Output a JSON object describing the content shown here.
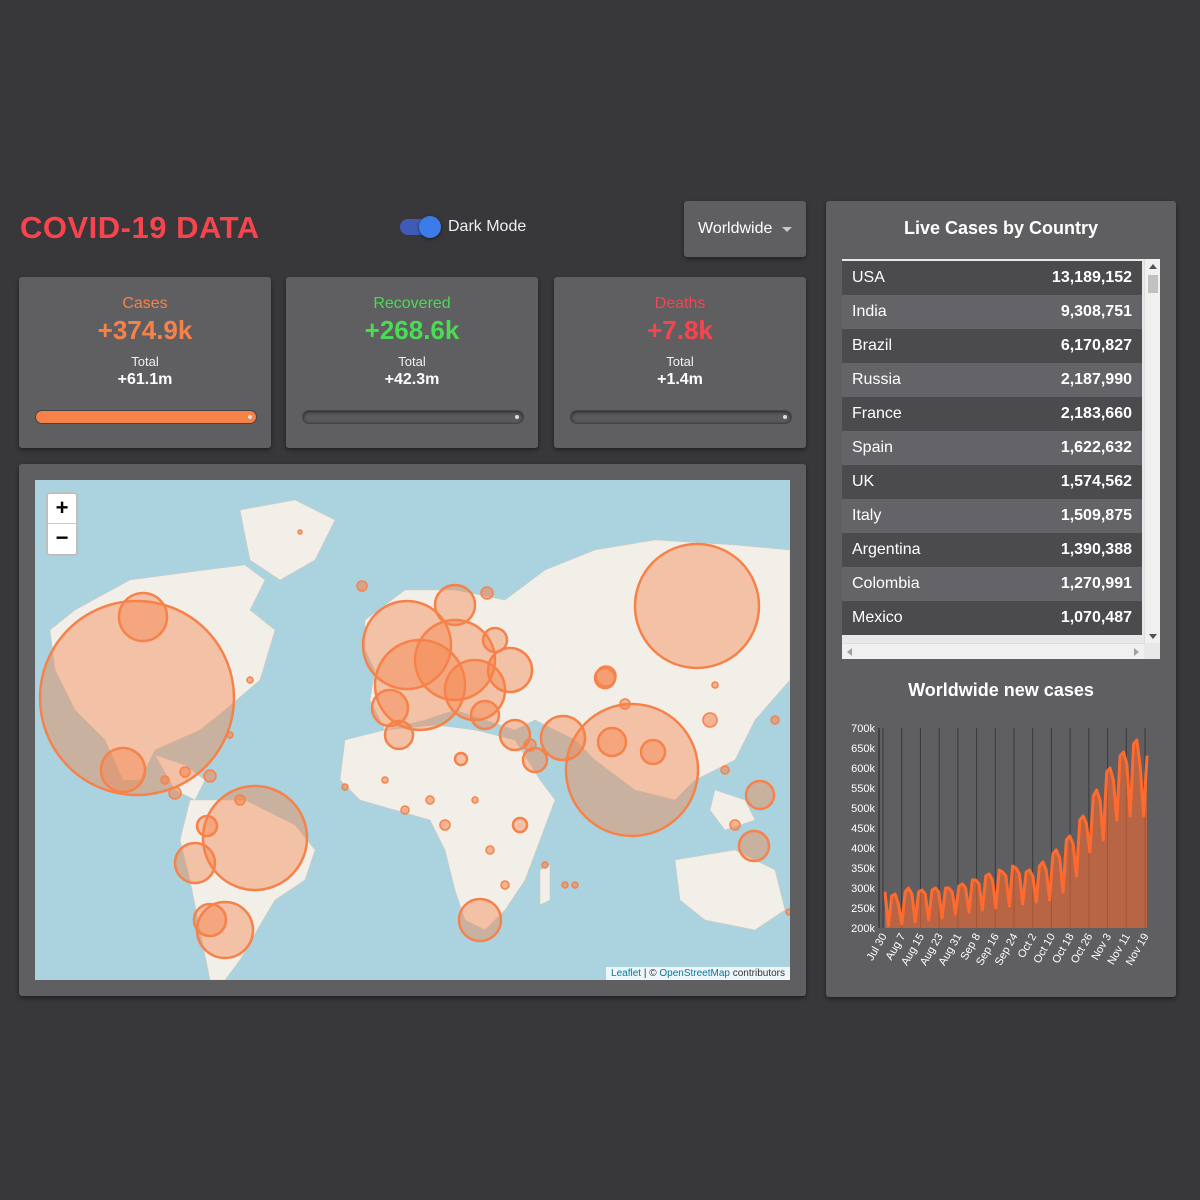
{
  "header": {
    "title": "COVID-19 DATA",
    "dark_mode_label": "Dark Mode",
    "dark_mode_on": true,
    "country_select": "Worldwide"
  },
  "cards": [
    {
      "title": "Cases",
      "today": "+374.9k",
      "total_label": "Total",
      "total": "+61.1m",
      "color": "#f6824a",
      "active": true
    },
    {
      "title": "Recovered",
      "today": "+268.6k",
      "total_label": "Total",
      "total": "+42.3m",
      "color": "#4bdb55",
      "active": false
    },
    {
      "title": "Deaths",
      "today": "+7.8k",
      "total_label": "Total",
      "total": "+1.4m",
      "color": "#f9444e",
      "active": false
    }
  ],
  "map": {
    "zoom_in": "+",
    "zoom_out": "−",
    "attribution_leaflet": "Leaflet",
    "attribution_sep": " | © ",
    "attribution_osm": "OpenStreetMap",
    "attribution_tail": " contributors",
    "circle_color": "#f6824a"
  },
  "table": {
    "title": "Live Cases by Country",
    "rows": [
      {
        "country": "USA",
        "cases": "13,189,152"
      },
      {
        "country": "India",
        "cases": "9,308,751"
      },
      {
        "country": "Brazil",
        "cases": "6,170,827"
      },
      {
        "country": "Russia",
        "cases": "2,187,990"
      },
      {
        "country": "France",
        "cases": "2,183,660"
      },
      {
        "country": "Spain",
        "cases": "1,622,632"
      },
      {
        "country": "UK",
        "cases": "1,574,562"
      },
      {
        "country": "Italy",
        "cases": "1,509,875"
      },
      {
        "country": "Argentina",
        "cases": "1,390,388"
      },
      {
        "country": "Colombia",
        "cases": "1,270,991"
      },
      {
        "country": "Mexico",
        "cases": "1,070,487"
      }
    ]
  },
  "chart_data": {
    "type": "area",
    "title": "Worldwide new cases",
    "y_ticks": [
      "200k",
      "250k",
      "300k",
      "350k",
      "400k",
      "450k",
      "500k",
      "550k",
      "600k",
      "650k",
      "700k"
    ],
    "ylim": [
      200000,
      700000
    ],
    "x_ticks": [
      "Jul 30",
      "Aug 7",
      "Aug 15",
      "Aug 23",
      "Aug 31",
      "Sep 8",
      "Sep 16",
      "Sep 24",
      "Oct 2",
      "Oct 10",
      "Oct 18",
      "Oct 26",
      "Nov 3",
      "Nov 11",
      "Nov 19"
    ],
    "grid": true,
    "line_color": "#ff6b2e",
    "values": [
      290000,
      205000,
      280000,
      285000,
      260000,
      210000,
      290000,
      300000,
      285000,
      215000,
      290000,
      295000,
      285000,
      220000,
      295000,
      300000,
      290000,
      225000,
      300000,
      300000,
      290000,
      235000,
      305000,
      310000,
      300000,
      240000,
      320000,
      320000,
      310000,
      245000,
      330000,
      335000,
      320000,
      250000,
      345000,
      340000,
      330000,
      255000,
      355000,
      350000,
      335000,
      260000,
      340000,
      345000,
      330000,
      265000,
      355000,
      365000,
      345000,
      270000,
      385000,
      395000,
      375000,
      290000,
      420000,
      430000,
      410000,
      330000,
      470000,
      480000,
      460000,
      390000,
      530000,
      545000,
      520000,
      420000,
      590000,
      600000,
      570000,
      470000,
      630000,
      640000,
      610000,
      480000,
      660000,
      670000,
      600000,
      480000,
      630000
    ]
  }
}
